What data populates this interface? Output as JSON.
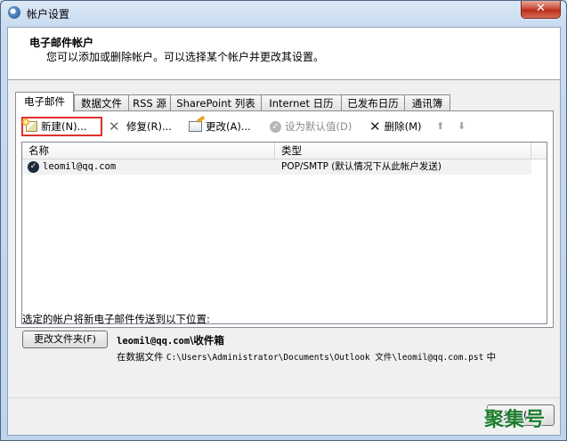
{
  "window": {
    "title": "帐户设置",
    "close_glyph": "✕"
  },
  "header": {
    "title": "电子邮件帐户",
    "subtitle": "您可以添加或删除帐户。可以选择某个帐户并更改其设置。"
  },
  "tabs": [
    {
      "label": "电子邮件",
      "active": true
    },
    {
      "label": "数据文件"
    },
    {
      "label": "RSS 源"
    },
    {
      "label": "SharePoint 列表"
    },
    {
      "label": "Internet 日历"
    },
    {
      "label": "已发布日历"
    },
    {
      "label": "通讯簿"
    }
  ],
  "toolbar": {
    "new_label": "新建(N)...",
    "repair_label": "修复(R)...",
    "change_label": "更改(A)...",
    "set_default_label": "设为默认值(D)",
    "delete_label": "删除(M)",
    "up_glyph": "⬆",
    "down_glyph": "⬇"
  },
  "accounts_table": {
    "columns": [
      "名称",
      "类型"
    ],
    "rows": [
      {
        "name": "leomil@qq.com",
        "type": "POP/SMTP (默认情况下从此帐户发送)"
      }
    ]
  },
  "delivery": {
    "label": "选定的帐户将新电子邮件传送到以下位置:",
    "change_folder_label": "更改文件夹(F)",
    "mailbox_account": "leomil@qq.com",
    "mailbox_folder": "\\收件箱",
    "datafile_prefix": "在数据文件",
    "datafile_path": "C:\\Users\\Administrator\\Documents\\Outlook 文件\\leomil@qq.com.pst",
    "datafile_suffix": "中"
  },
  "footer": {
    "close_label": "关闭(C)"
  },
  "watermark": "聚集号",
  "colors": {
    "focus_border": "#e0302e",
    "close_button": "#c8432f"
  }
}
